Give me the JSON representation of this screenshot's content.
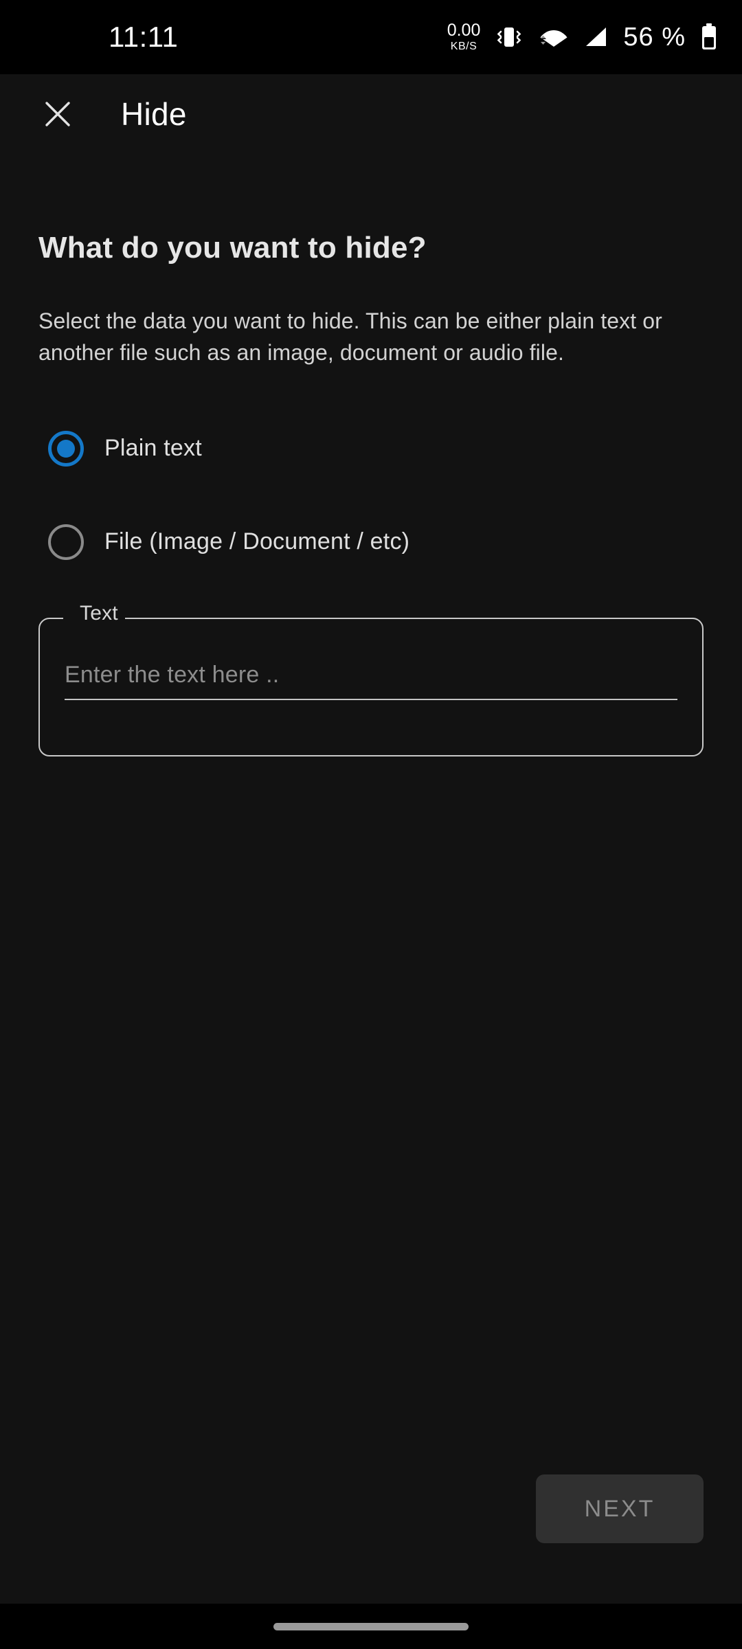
{
  "status_bar": {
    "clock": "11:11",
    "net_speed_value": "0.00",
    "net_speed_unit": "KB/S",
    "icons": [
      "vibrate-icon",
      "wifi-icon",
      "cellular-signal-icon",
      "battery-icon"
    ],
    "battery_percent": "56 %"
  },
  "app_bar": {
    "close_icon": "close-icon",
    "title": "Hide"
  },
  "main": {
    "heading": "What do you want to hide?",
    "description": "Select the data you want to hide. This can be either plain text or another file such as an image, document or audio file.",
    "radio_options": [
      {
        "label": "Plain text",
        "selected": true
      },
      {
        "label": "File (Image / Document / etc)",
        "selected": false
      }
    ],
    "text_field": {
      "legend": "Text",
      "placeholder": "Enter the text here ..",
      "value": ""
    },
    "next_button": {
      "label": "NEXT",
      "enabled": false
    }
  },
  "nav_bar": {
    "gesture_pill": "home-gesture-pill"
  },
  "colors": {
    "background": "#121212",
    "status_bar_bg": "#000000",
    "accent_blue": "#1478c8",
    "radio_unselected": "#8a8a8a",
    "field_border": "#c9c9c9",
    "next_button_bg": "#303030",
    "next_button_text": "#8c8c8c"
  }
}
